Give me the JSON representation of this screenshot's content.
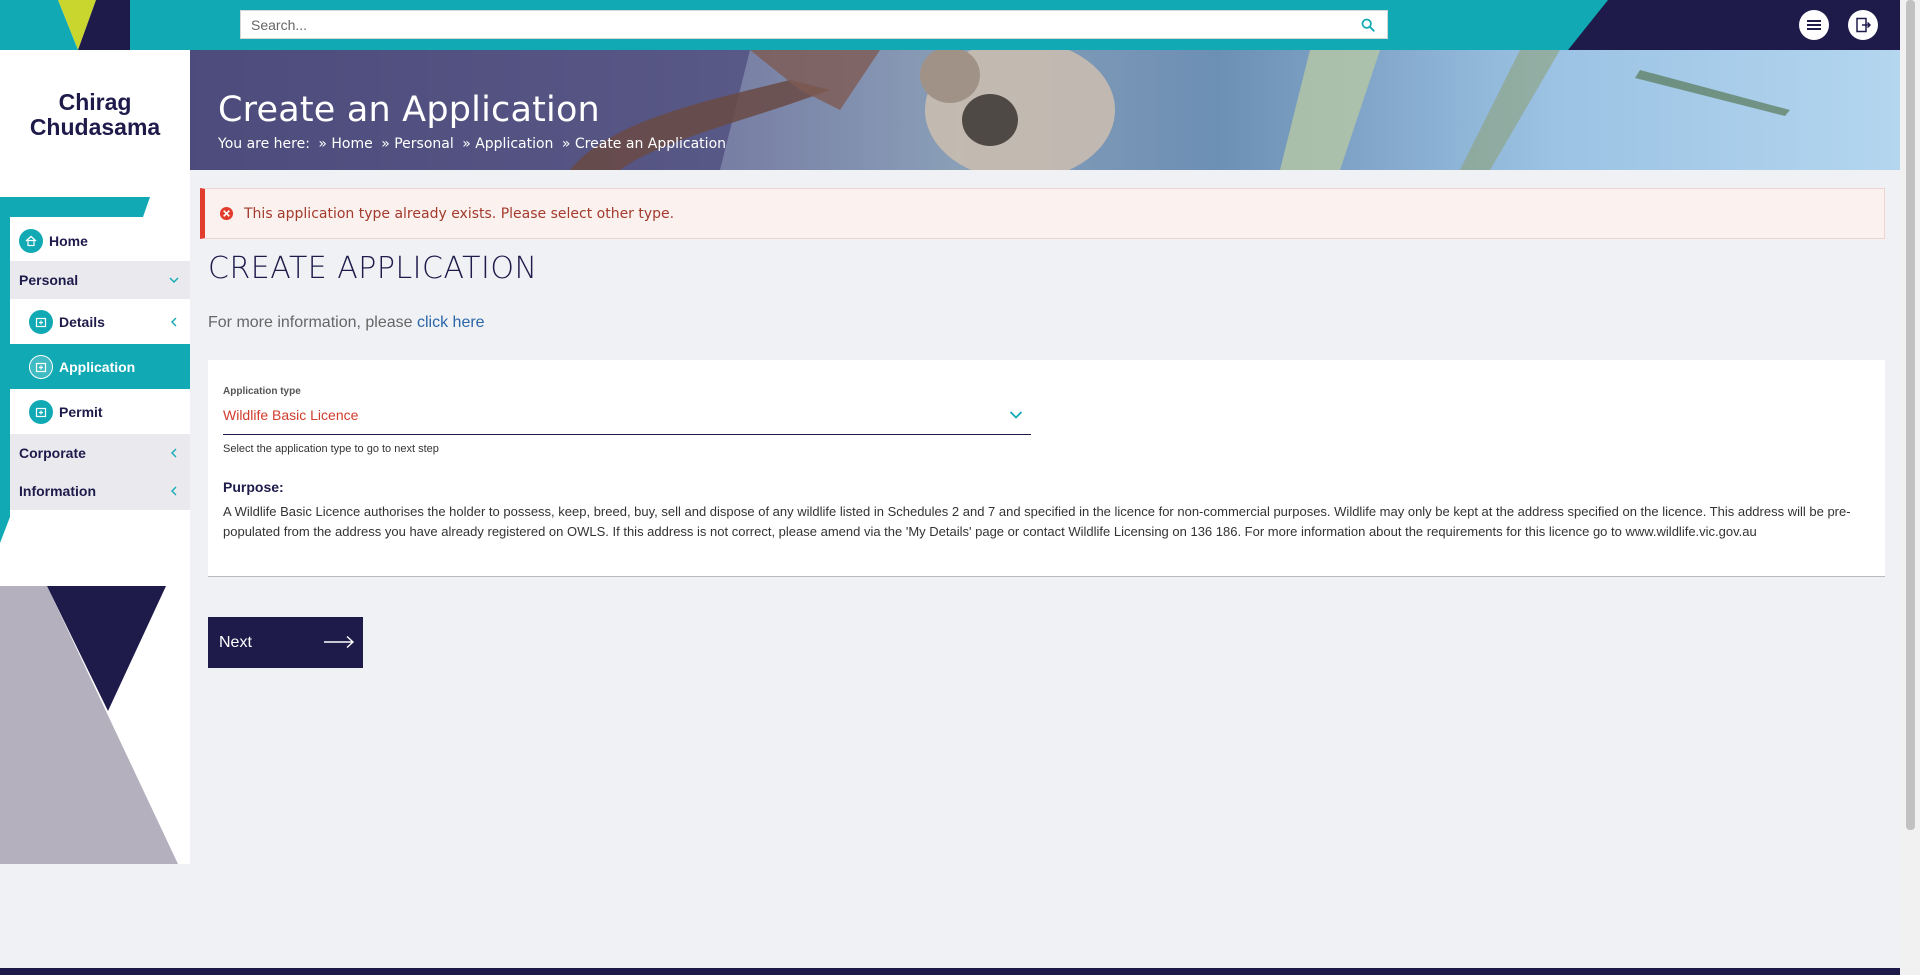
{
  "header": {
    "search_placeholder": "Search...",
    "menu_icon": "hamburger-menu-icon",
    "logout_icon": "logout-icon"
  },
  "user": {
    "name_line1": "Chirag",
    "name_line2": "Chudasama"
  },
  "sidebar": {
    "items": [
      {
        "label": "Home",
        "icon": "home-icon"
      },
      {
        "label": "Personal"
      },
      {
        "label": "Details",
        "icon": "folder-icon"
      },
      {
        "label": "Application",
        "icon": "folder-icon",
        "active": true
      },
      {
        "label": "Permit",
        "icon": "folder-icon"
      },
      {
        "label": "Corporate"
      },
      {
        "label": "Information"
      }
    ]
  },
  "banner": {
    "title": "Create an Application",
    "breadcrumb_prefix": "You are here:",
    "breadcrumb": [
      "» Home",
      "» Personal",
      "» Application",
      "» Create an Application"
    ]
  },
  "alert": {
    "text": "This application type already exists. Please select other type."
  },
  "main": {
    "title": "CREATE APPLICATION",
    "more_info_text": "For more information, please",
    "more_info_link": "click here"
  },
  "form": {
    "application_type_label": "Application type",
    "application_type_value": "Wildlife Basic Licence",
    "helper": "Select the application type to go to next step",
    "purpose_label": "Purpose:",
    "purpose_text": "A Wildlife Basic Licence authorises the holder to possess, keep, breed, buy, sell and dispose of any wildlife listed in Schedules 2 and 7 and specified in the licence for non-commercial purposes. Wildlife may only be kept at the address specified on the licence. This address will be pre-populated from the address you have already registered on OWLS. If this address is not correct, please amend via the 'My Details' page or contact Wildlife Licensing on 136 186. For more information about the requirements for this licence go to www.wildlife.vic.gov.au",
    "next_label": "Next"
  },
  "colors": {
    "teal": "#11aab4",
    "navy": "#1e1b4b",
    "error": "#e23c2c"
  }
}
